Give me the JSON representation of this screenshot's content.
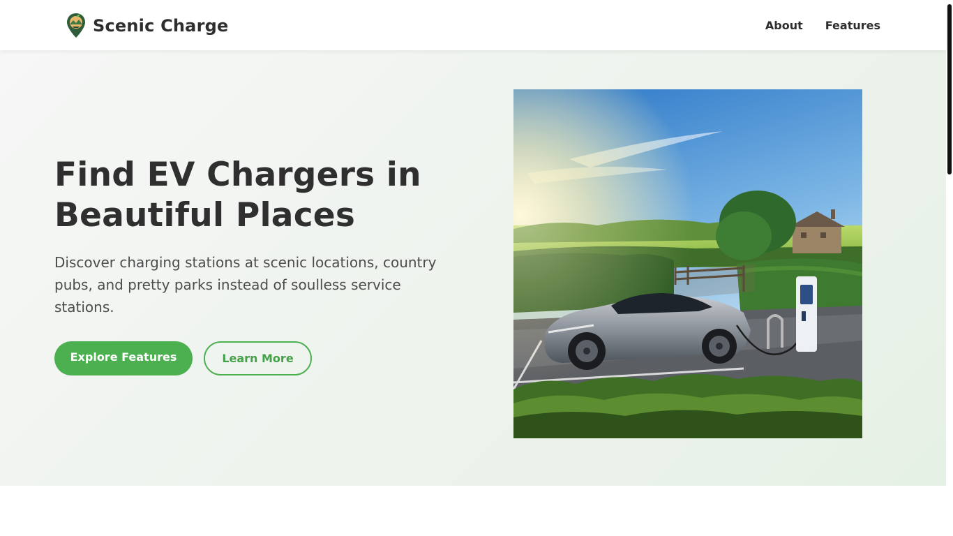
{
  "header": {
    "brand_name": "Scenic Charge",
    "nav": [
      {
        "label": "About"
      },
      {
        "label": "Features"
      }
    ]
  },
  "hero": {
    "title": "Find EV Chargers in Beautiful Places",
    "description": "Discover charging stations at scenic locations, country pubs, and pretty parks instead of soulless service stations.",
    "primary_button": "Explore Features",
    "secondary_button": "Learn More",
    "image_subject": "electric car charging beside a hedge and country house under a blue sky"
  },
  "colors": {
    "accent": "#4caf50",
    "text": "#2f2f2f",
    "hero_bg_start": "#f6f7f6",
    "hero_bg_end": "#e6f1e5"
  },
  "icons": {
    "logo": "map-pin-leaf-icon"
  }
}
